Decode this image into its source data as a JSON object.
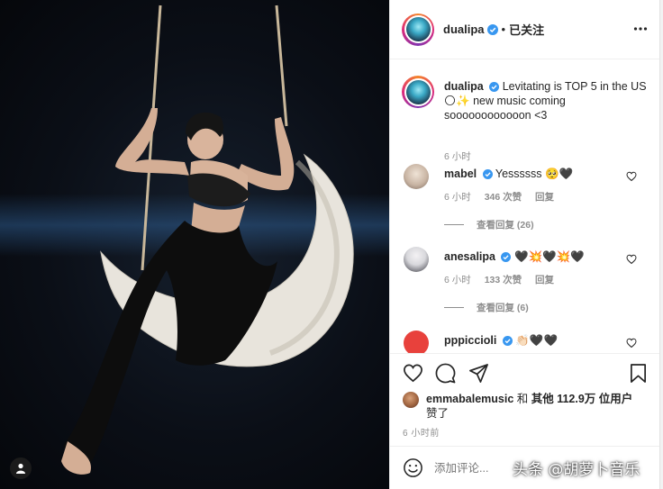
{
  "post": {
    "author": "dualipa",
    "follow_status": "已关注",
    "separator": "•"
  },
  "caption": {
    "username": "dualipa",
    "text": "Levitating is TOP 5 in the US 🌕✨ new music coming soooooooooooon <3",
    "time": "6 小时"
  },
  "comments": [
    {
      "username": "mabel",
      "text": "Yessssss 🥺🖤",
      "time": "6 小时",
      "likes": "346 次赞",
      "reply": "回复",
      "view_replies": "查看回复 (26)",
      "avatar_color": "#c9b5a4"
    },
    {
      "username": "anesalipa",
      "text": "🖤💥🖤💥🖤",
      "time": "6 小时",
      "likes": "133 次赞",
      "reply": "回复",
      "view_replies": "查看回复 (6)",
      "avatar_color": "#d8d8dc"
    },
    {
      "username": "pppiccioli",
      "text": "👏🏻🖤🖤",
      "avatar_color": "#e8413c"
    }
  ],
  "likes": {
    "user": "emmabalemusic",
    "text_mid": " 和 ",
    "others": "其他 112.9万 位用户",
    "text_end": "赞了"
  },
  "post_time": "6 小时前",
  "comment_input": {
    "placeholder": "添加评论..."
  },
  "watermark": "头条 @胡萝卜音乐",
  "colors": {
    "verified": "#3897f0",
    "secondary_text": "#8e8e8e",
    "primary_text": "#262626"
  }
}
